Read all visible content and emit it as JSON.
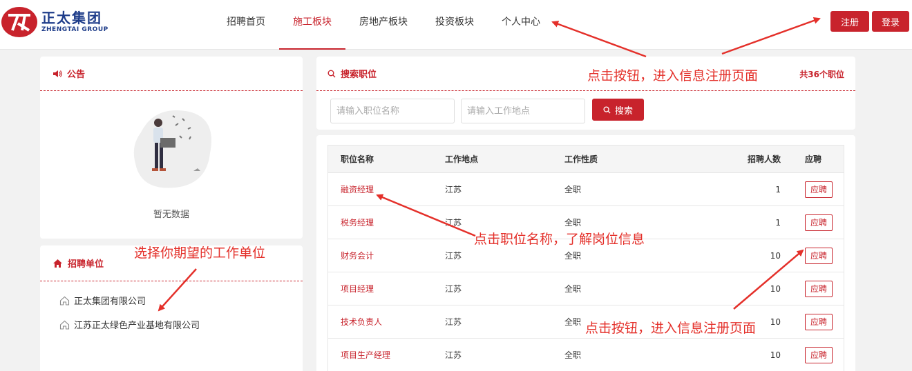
{
  "header": {
    "logo_cn": "正太集团",
    "logo_en": "ZHENGTAI GROUP",
    "nav": [
      {
        "label": "招聘首页"
      },
      {
        "label": "施工板块"
      },
      {
        "label": "房地产板块"
      },
      {
        "label": "投资板块"
      },
      {
        "label": "个人中心"
      }
    ],
    "active_nav": "施工板块",
    "register_label": "注册",
    "login_label": "登录"
  },
  "notice": {
    "title": "公告",
    "empty_text": "暂无数据"
  },
  "units": {
    "title": "招聘单位",
    "items": [
      {
        "label": "正太集团有限公司"
      },
      {
        "label": "江苏正太绿色产业基地有限公司"
      }
    ]
  },
  "search": {
    "title": "搜索职位",
    "count_text": "共36个职位",
    "name_placeholder": "请输入职位名称",
    "location_placeholder": "请输入工作地点",
    "button_label": "搜索"
  },
  "table": {
    "headers": {
      "name": "职位名称",
      "location": "工作地点",
      "type": "工作性质",
      "count": "招聘人数",
      "apply": "应聘"
    },
    "rows": [
      {
        "name": "融资经理",
        "location": "江苏",
        "type": "全职",
        "count": "1",
        "apply": "应聘"
      },
      {
        "name": "税务经理",
        "location": "江苏",
        "type": "全职",
        "count": "1",
        "apply": "应聘"
      },
      {
        "name": "财务会计",
        "location": "江苏",
        "type": "全职",
        "count": "10",
        "apply": "应聘"
      },
      {
        "name": "项目经理",
        "location": "江苏",
        "type": "全职",
        "count": "10",
        "apply": "应聘"
      },
      {
        "name": "技术负责人",
        "location": "江苏",
        "type": "全职",
        "count": "10",
        "apply": "应聘"
      },
      {
        "name": "项目生产经理",
        "location": "江苏",
        "type": "全职",
        "count": "10",
        "apply": "应聘"
      }
    ]
  },
  "annotations": {
    "top_right": "点击按钮，进入信息注册页面",
    "units": "选择你期望的工作单位",
    "job_name": "点击职位名称，了解岗位信息",
    "apply": "点击按钮，进入信息注册页面"
  },
  "colors": {
    "brand_red": "#c8232c",
    "logo_blue": "#1f3d8a",
    "annotation_red": "#e4302a"
  }
}
